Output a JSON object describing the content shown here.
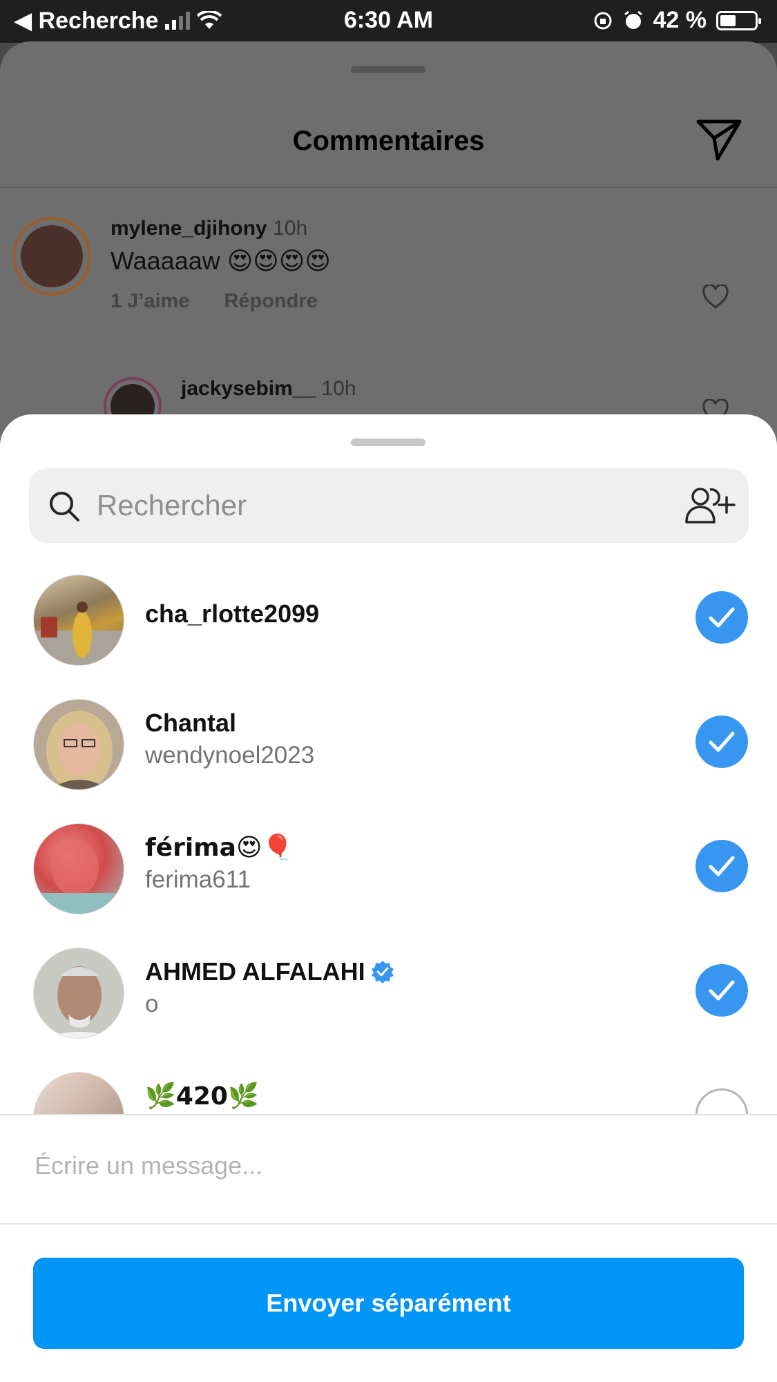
{
  "status_bar": {
    "back_label": "◀ Recherche",
    "time": "6:30 AM",
    "battery": "42 %"
  },
  "comments": {
    "title": "Commentaires",
    "items": [
      {
        "username": "mylene_djihony",
        "age": "10h",
        "text": "Waaaaaw 😍😍😍😍",
        "likes": "1 J’aime",
        "reply": "Répondre"
      },
      {
        "username": "jackysebim__",
        "age": "10h"
      }
    ]
  },
  "share": {
    "search_placeholder": "Rechercher",
    "recipients": [
      {
        "primary": "cha_rlotte2099",
        "secondary": "",
        "selected": true,
        "verified": false,
        "avatar_color": "#b98b4a"
      },
      {
        "primary": "Chantal",
        "secondary": "wendynoel2023",
        "selected": true,
        "verified": false,
        "avatar_color": "#c9a788"
      },
      {
        "primary": "férima😍🎈",
        "secondary": "ferima611",
        "selected": true,
        "verified": false,
        "avatar_color": "#d25b5b"
      },
      {
        "primary": "AHMED ALFALAHI",
        "secondary": "o",
        "selected": true,
        "verified": true,
        "avatar_color": "#8a8a86"
      },
      {
        "primary": "🌿420🌿",
        "secondary": "",
        "selected": false,
        "verified": false,
        "avatar_color": "#d8c7bd"
      }
    ],
    "message_placeholder": "Écrire un message...",
    "send_label": "Envoyer séparément"
  },
  "colors": {
    "accent": "#0095f6",
    "check": "#3797f0",
    "verified": "#3797f0"
  }
}
